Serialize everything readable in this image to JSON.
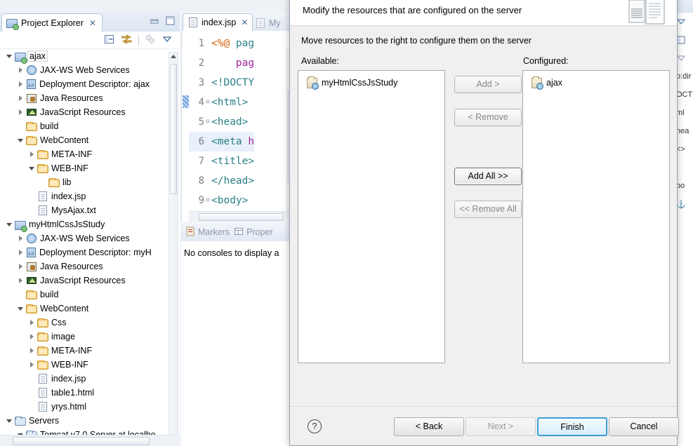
{
  "workbench": {
    "project_explorer": {
      "tab_label": "Project Explorer",
      "close_glyph": "✕",
      "toolbar": [
        {
          "name": "collapse-all-icon",
          "label": "Collapse All"
        },
        {
          "name": "link-with-editor-icon",
          "label": "Link with Editor"
        },
        {
          "name": "filter-icon",
          "label": "Filters"
        },
        {
          "name": "view-menu-icon",
          "label": "View Menu"
        }
      ],
      "tree": [
        {
          "label": "ajax",
          "indent": 0,
          "twisty": "expanded",
          "icon": "project-icon",
          "selected": true
        },
        {
          "label": "JAX-WS Web Services",
          "indent": 1,
          "twisty": "collapsed",
          "icon": "webservice-icon"
        },
        {
          "label": "Deployment Descriptor: ajax",
          "indent": 1,
          "twisty": "collapsed",
          "icon": "deployment-descriptor-icon"
        },
        {
          "label": "Java Resources",
          "indent": 1,
          "twisty": "collapsed",
          "icon": "java-resources-icon"
        },
        {
          "label": "JavaScript Resources",
          "indent": 1,
          "twisty": "collapsed",
          "icon": "javascript-resources-icon"
        },
        {
          "label": "build",
          "indent": 1,
          "twisty": "none",
          "icon": "folder-icon"
        },
        {
          "label": "WebContent",
          "indent": 1,
          "twisty": "expanded",
          "icon": "folder-icon"
        },
        {
          "label": "META-INF",
          "indent": 2,
          "twisty": "collapsed",
          "icon": "folder-icon"
        },
        {
          "label": "WEB-INF",
          "indent": 2,
          "twisty": "expanded",
          "icon": "folder-icon"
        },
        {
          "label": "lib",
          "indent": 3,
          "twisty": "none",
          "icon": "folder-icon"
        },
        {
          "label": "index.jsp",
          "indent": 2,
          "twisty": "none",
          "icon": "file-icon"
        },
        {
          "label": "MysAjax.txt",
          "indent": 2,
          "twisty": "none",
          "icon": "file-icon"
        },
        {
          "label": "myHtmlCssJsStudy",
          "indent": 0,
          "twisty": "expanded",
          "icon": "project-icon"
        },
        {
          "label": "JAX-WS Web Services",
          "indent": 1,
          "twisty": "collapsed",
          "icon": "webservice-icon"
        },
        {
          "label": "Deployment Descriptor: myH",
          "indent": 1,
          "twisty": "collapsed",
          "icon": "deployment-descriptor-icon"
        },
        {
          "label": "Java Resources",
          "indent": 1,
          "twisty": "collapsed",
          "icon": "java-resources-icon"
        },
        {
          "label": "JavaScript Resources",
          "indent": 1,
          "twisty": "collapsed",
          "icon": "javascript-resources-icon"
        },
        {
          "label": "build",
          "indent": 1,
          "twisty": "none",
          "icon": "folder-icon"
        },
        {
          "label": "WebContent",
          "indent": 1,
          "twisty": "expanded",
          "icon": "folder-icon"
        },
        {
          "label": "Css",
          "indent": 2,
          "twisty": "collapsed",
          "icon": "folder-icon"
        },
        {
          "label": "image",
          "indent": 2,
          "twisty": "collapsed",
          "icon": "folder-icon"
        },
        {
          "label": "META-INF",
          "indent": 2,
          "twisty": "collapsed",
          "icon": "folder-icon"
        },
        {
          "label": "WEB-INF",
          "indent": 2,
          "twisty": "collapsed",
          "icon": "folder-icon"
        },
        {
          "label": "index.jsp",
          "indent": 2,
          "twisty": "none",
          "icon": "file-icon"
        },
        {
          "label": "table1.html",
          "indent": 2,
          "twisty": "none",
          "icon": "file-icon"
        },
        {
          "label": "yrys.html",
          "indent": 2,
          "twisty": "none",
          "icon": "file-icon"
        },
        {
          "label": "Servers",
          "indent": 0,
          "twisty": "expanded",
          "icon": "server-folder-icon"
        },
        {
          "label": "Tomcat v7.0 Server at localho",
          "indent": 1,
          "twisty": "expanded",
          "icon": "server-folder-icon"
        }
      ]
    },
    "editor": {
      "tab_active": "index.jsp",
      "tab_inactive": "My",
      "close_glyph": "✕",
      "lines": [
        {
          "num": "1",
          "fold": "",
          "segments": [
            {
              "text": "<%@ ",
              "cls": "k-dir"
            },
            {
              "text": "pag",
              "cls": "k-teal"
            }
          ]
        },
        {
          "num": "2",
          "fold": "",
          "segments": [
            {
              "text": "    ",
              "cls": ""
            },
            {
              "text": "pag",
              "cls": "k-attr"
            }
          ]
        },
        {
          "num": "3",
          "fold": "",
          "segments": [
            {
              "text": "<!DOCTY",
              "cls": "k-teal"
            }
          ]
        },
        {
          "num": "4",
          "fold": "⊖",
          "segments": [
            {
              "text": "<html>",
              "cls": "k-tag"
            }
          ]
        },
        {
          "num": "5",
          "fold": "⊖",
          "segments": [
            {
              "text": "<head>",
              "cls": "k-tag"
            }
          ]
        },
        {
          "num": "6",
          "fold": "",
          "segments": [
            {
              "text": "<meta ",
              "cls": "k-tag"
            },
            {
              "text": "h",
              "cls": "k-attr"
            }
          ],
          "highlight": true
        },
        {
          "num": "7",
          "fold": "",
          "segments": [
            {
              "text": "<title>",
              "cls": "k-tag"
            }
          ]
        },
        {
          "num": "8",
          "fold": "",
          "segments": [
            {
              "text": "</head>",
              "cls": "k-tag"
            }
          ]
        },
        {
          "num": "9",
          "fold": "⊖",
          "segments": [
            {
              "text": "<body>",
              "cls": "k-tag"
            }
          ]
        }
      ]
    },
    "bottom_view": {
      "tabs": [
        {
          "label": "Markers",
          "icon": "markers-icon"
        },
        {
          "label": "Proper",
          "icon": "properties-icon"
        }
      ],
      "console_message": "No consoles to display a"
    },
    "outline_strip": {
      "rows": [
        "o:dir",
        "OCTY",
        "ml",
        "hea",
        "<>",
        "",
        "bo",
        "⚓"
      ]
    }
  },
  "dialog": {
    "header_title": "Modify the resources that are configured on the server",
    "header_icon": "server-resources-icon",
    "instruction": "Move resources to the right to configure them on the server",
    "available_label": "Available:",
    "configured_label": "Configured:",
    "available_items": [
      {
        "label": "myHtmlCssJsStudy",
        "icon": "project-icon"
      }
    ],
    "configured_items": [
      {
        "label": "ajax",
        "icon": "project-icon"
      }
    ],
    "transfer_buttons": [
      {
        "label": "Add >",
        "name": "add-button",
        "enabled": false
      },
      {
        "label": "< Remove",
        "name": "remove-button",
        "enabled": false
      },
      {
        "label": "Add All >>",
        "name": "add-all-button",
        "enabled": true
      },
      {
        "label": "<< Remove All",
        "name": "remove-all-button",
        "enabled": false
      }
    ],
    "help_glyph": "?",
    "footer_buttons": [
      {
        "label": "< Back",
        "name": "back-button",
        "state": "enabled"
      },
      {
        "label": "Next >",
        "name": "next-button",
        "state": "disabled"
      },
      {
        "label": "Finish",
        "name": "finish-button",
        "state": "default"
      },
      {
        "label": "Cancel",
        "name": "cancel-button",
        "state": "enabled"
      }
    ]
  }
}
